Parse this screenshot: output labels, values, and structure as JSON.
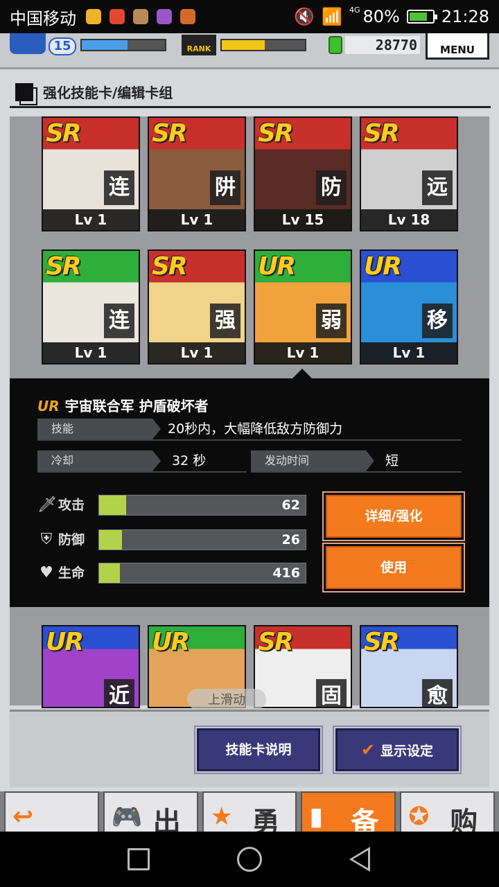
{
  "statusbar": {
    "carrier": "中国移动",
    "network": "4G",
    "battery": "80%",
    "time": "21:28"
  },
  "hud": {
    "level": "15",
    "rank_label": "RANK",
    "money": "28770",
    "menu_label": "MENU"
  },
  "page": {
    "title": "强化技能卡/编辑卡组"
  },
  "cards_top": [
    {
      "rarity": "SR",
      "char": "连",
      "level": "Lv 1",
      "bg": "#c8302c",
      "art": "#e8e2da"
    },
    {
      "rarity": "SR",
      "char": "阱",
      "level": "Lv 1",
      "bg": "#c8302c",
      "art": "#8a5b3f"
    },
    {
      "rarity": "SR",
      "char": "防",
      "level": "Lv 15",
      "bg": "#c8302c",
      "art": "#5a2a24"
    },
    {
      "rarity": "SR",
      "char": "远",
      "level": "Lv 18",
      "bg": "#c8302c",
      "art": "#cfcfcf"
    }
  ],
  "cards_mid": [
    {
      "rarity": "SR",
      "char": "连",
      "level": "Lv 1",
      "bg": "#2eae3a",
      "art": "#ece7de"
    },
    {
      "rarity": "SR",
      "char": "强",
      "level": "Lv 1",
      "bg": "#c8302c",
      "art": "#f0d48a"
    },
    {
      "rarity": "UR",
      "char": "弱",
      "level": "Lv 1",
      "bg": "#2eae3a",
      "art": "#f2a23c"
    },
    {
      "rarity": "UR",
      "char": "移",
      "level": "Lv 1",
      "bg": "#2a4fd0",
      "art": "#2b8fd8"
    }
  ],
  "cards_bottom": [
    {
      "rarity": "UR",
      "char": "近",
      "bg": "#2a4fd0",
      "art": "#a043c8"
    },
    {
      "rarity": "UR",
      "char": "",
      "bg": "#2eae3a",
      "art": "#e3a45a"
    },
    {
      "rarity": "SR",
      "char": "固",
      "bg": "#c8302c",
      "art": "#eeeeee"
    },
    {
      "rarity": "SR",
      "char": "愈",
      "bg": "#2a4fd0",
      "art": "#c9d6f2"
    }
  ],
  "detail": {
    "rarity": "UR",
    "name": "宇宙联合军 护盾破坏者",
    "skill_label": "技能",
    "skill_text": "20秒内，大幅降低敌方防御力",
    "cooldown_label": "冷却",
    "cooldown_value": "32 秒",
    "activation_label": "发动时间",
    "activation_value": "短",
    "stats": [
      {
        "label": "攻击",
        "value": "62",
        "fill_pct": 13
      },
      {
        "label": "防御",
        "value": "26",
        "fill_pct": 11
      },
      {
        "label": "生命",
        "value": "416",
        "fill_pct": 10
      }
    ],
    "detail_button": "详细/强化",
    "use_button": "使用"
  },
  "scroll_hint": "上滑动",
  "buttons": {
    "skill_card_help": "技能卡说明",
    "display_settings": "显示设定"
  },
  "tabs": [
    {
      "label": "",
      "icon": "back-arrow"
    },
    {
      "label": "出",
      "icon": "controller"
    },
    {
      "label": "勇",
      "icon": "hero"
    },
    {
      "label": "备",
      "icon": "equipment"
    },
    {
      "label": "购",
      "icon": "shop"
    }
  ]
}
